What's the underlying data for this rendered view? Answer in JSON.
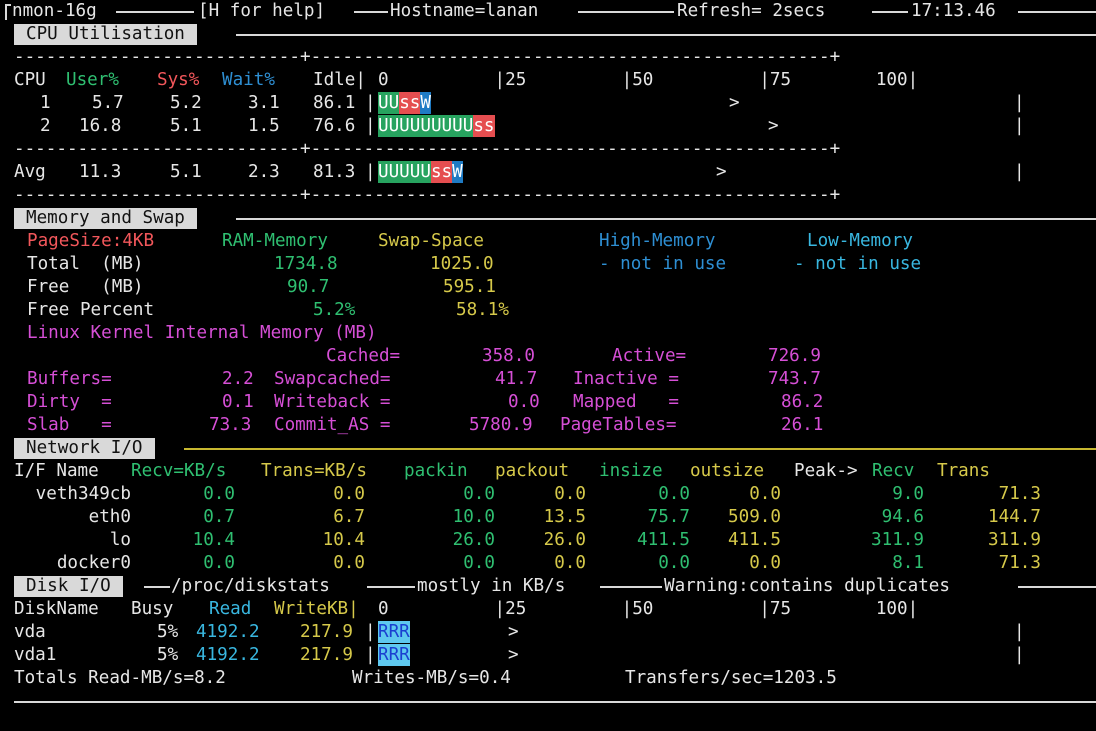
{
  "header": {
    "app": "nmon-16g",
    "help": "[H for help]",
    "hostname": "Hostname=lanan",
    "refresh": "Refresh= 2secs",
    "time": "17:13.46"
  },
  "cpu": {
    "section_title": "CPU Utilisation",
    "dash_line": "---------------------------+-------------------------------------------------+",
    "headers": {
      "cpu": "CPU",
      "user": "User%",
      "sys": "Sys%",
      "wait": "Wait%",
      "idle": "Idle|"
    },
    "scale": "0          |25         |50          |75        100|",
    "rows": [
      {
        "cpu": "1",
        "user": "5.7",
        "sys": "5.2",
        "wait": "3.1",
        "idle": "86.1",
        "bar_u": "UU",
        "bar_s": "ss",
        "bar_w": "W",
        "marker": ">",
        "pct": [
          5.7,
          5.2,
          3.1
        ]
      },
      {
        "cpu": "2",
        "user": "16.8",
        "sys": "5.1",
        "wait": "1.5",
        "idle": "76.6",
        "bar_u": "UUUUUUUUU",
        "bar_s": "ss",
        "bar_w": "",
        "marker": ">",
        "pct": [
          16.8,
          5.1,
          1.5
        ]
      }
    ],
    "avg": {
      "label": "Avg",
      "user": "11.3",
      "sys": "5.1",
      "wait": "2.3",
      "idle": "81.3",
      "bar_u": "UUUUU",
      "bar_s": "ss",
      "bar_w": "W",
      "marker": ">",
      "pct": [
        11.3,
        5.1,
        2.3
      ]
    },
    "end_bar": "|"
  },
  "memory": {
    "section_title": "Memory and Swap",
    "pagesize": "PageSize:4KB",
    "ram_hdr": "RAM-Memory",
    "swap_hdr": "Swap-Space",
    "high_hdr": "High-Memory",
    "low_hdr": "Low-Memory",
    "high_note": "- not in use",
    "low_note": "- not in use",
    "total_label": "Total  (MB)",
    "free_label": "Free   (MB)",
    "freepct_label": "Free Percent",
    "ram_total": "1734.8",
    "swap_total": "1025.0",
    "ram_free": "90.7",
    "swap_free": "595.1",
    "ram_pct": "5.2%",
    "swap_pct": "58.1%",
    "kernel_title": "Linux Kernel Internal Memory (MB)",
    "cached_l": "Cached=",
    "cached_v": "358.0",
    "active_l": "Active=",
    "active_v": "726.9",
    "buffers_l": "Buffers=",
    "buffers_v": "2.2",
    "swapcached_l": "Swapcached=",
    "swapcached_v": "41.7",
    "inactive_l": "Inactive =",
    "inactive_v": "743.7",
    "dirty_l": "Dirty  =",
    "dirty_v": "0.1",
    "writeback_l": "Writeback =",
    "writeback_v": "0.0",
    "mapped_l": "Mapped   =",
    "mapped_v": "86.2",
    "slab_l": "Slab   =",
    "slab_v": "73.3",
    "commit_l": "Commit_AS =",
    "commit_v": "5780.9",
    "pagetables_l": "PageTables=",
    "pagetables_v": "26.1"
  },
  "network": {
    "section_title": "Network I/O",
    "hdr_ifname": "I/F Name",
    "hdr_recv": "Recv=KB/s",
    "hdr_trans": "Trans=KB/s",
    "hdr_packin": "packin",
    "hdr_packout": "packout",
    "hdr_insize": "insize",
    "hdr_outsize": "outsize",
    "hdr_peak": "Peak->",
    "hdr_peakrecv": "Recv",
    "hdr_peaktrans": "Trans",
    "rows": [
      {
        "name": "veth349cb",
        "recv": "0.0",
        "trans": "0.0",
        "packin": "0.0",
        "packout": "0.0",
        "insize": "0.0",
        "outsize": "0.0",
        "peakrecv": "9.0",
        "peaktrans": "71.3"
      },
      {
        "name": "eth0",
        "recv": "0.7",
        "trans": "6.7",
        "packin": "10.0",
        "packout": "13.5",
        "insize": "75.7",
        "outsize": "509.0",
        "peakrecv": "94.6",
        "peaktrans": "144.7"
      },
      {
        "name": "lo",
        "recv": "10.4",
        "trans": "10.4",
        "packin": "26.0",
        "packout": "26.0",
        "insize": "411.5",
        "outsize": "411.5",
        "peakrecv": "311.9",
        "peaktrans": "311.9"
      },
      {
        "name": "docker0",
        "recv": "0.0",
        "trans": "0.0",
        "packin": "0.0",
        "packout": "0.0",
        "insize": "0.0",
        "outsize": "0.0",
        "peakrecv": "8.1",
        "peaktrans": "71.3"
      }
    ]
  },
  "disk": {
    "section_title": "Disk I/O",
    "source": "/proc/diskstats",
    "units": "mostly in KB/s",
    "warning": "Warning:contains duplicates",
    "hdr_name": "DiskName",
    "hdr_busy": "Busy",
    "hdr_read": "Read",
    "hdr_write": "WriteKB|",
    "scale": "0          |25         |50          |75        100|",
    "rows": [
      {
        "name": "vda",
        "busy": "5%",
        "read": "4192.2",
        "write": "217.9",
        "bar": "RRR",
        "marker": ">"
      },
      {
        "name": "vda1",
        "busy": "5%",
        "read": "4192.2",
        "write": "217.9",
        "bar": "RRR",
        "marker": ">"
      }
    ],
    "totals_read": "Totals Read-MB/s=8.2",
    "totals_write": "Writes-MB/s=0.4",
    "totals_xfer": "Transfers/sec=1203.5"
  }
}
